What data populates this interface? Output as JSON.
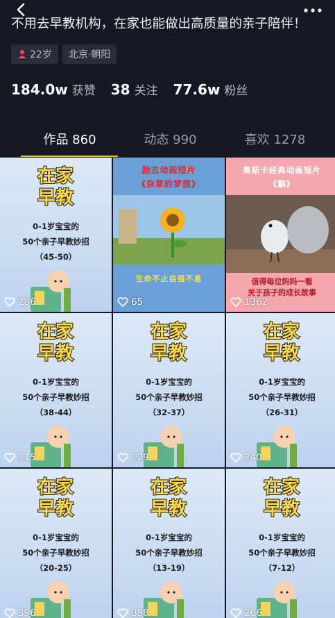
{
  "bio": "不用去早教机构，在家也能做出高质量的亲子陪伴！",
  "tags": [
    {
      "label": "22岁",
      "icon": "female-icon"
    },
    {
      "label": "北京·朝阳"
    }
  ],
  "stats": [
    {
      "value": "184.0w",
      "label": "获赞"
    },
    {
      "value": "38",
      "label": "关注"
    },
    {
      "value": "77.6w",
      "label": "粉丝"
    }
  ],
  "tabs": [
    {
      "label": "作品 860"
    },
    {
      "label": "动态 990"
    },
    {
      "label": "喜欢 1278"
    }
  ],
  "edu_logo": {
    "line1": "在家",
    "line2": "早教"
  },
  "edu_title": {
    "line1": "0-1岁宝宝的",
    "line2": "50个亲子早教妙招"
  },
  "posters": {
    "p1": {
      "top": "励志动画短片",
      "sub": "《杂草的梦想》",
      "bottom": "生命不止自强不息",
      "likes": "65"
    },
    "p2": {
      "top": "奥斯卡经典动画短片",
      "sub": "《鹬》",
      "bottom1": "值得每位妈妈一看",
      "bottom2": "关于孩子的成长故事",
      "likes": "1362"
    }
  },
  "edu_cards": [
    {
      "range": "（45-50）",
      "likes": "286"
    },
    {
      "range": "（38-44）",
      "likes": "115"
    },
    {
      "range": "（32-37）",
      "likes": "129"
    },
    {
      "range": "（26-31）",
      "likes": "240"
    },
    {
      "range": "（20-25）",
      "likes": "396"
    },
    {
      "range": "（13-19）",
      "likes": "858"
    },
    {
      "range": "（7-12）",
      "likes": "206"
    }
  ],
  "colors": {
    "background": "#161823",
    "tab_indicator": "#f5c722",
    "tag_bg": "#2a2c38",
    "female_icon": "#f0476a"
  }
}
